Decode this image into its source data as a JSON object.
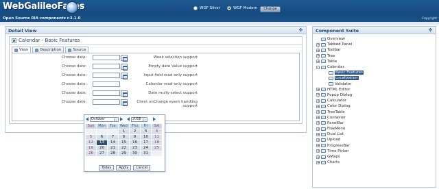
{
  "app": {
    "logo_text": "WebGalileoFaces",
    "subtitle": "Open Source RIA components r.3.1.0",
    "copyright": "Copyright",
    "themes": [
      {
        "label": "WGF Silver",
        "selected": false
      },
      {
        "label": "WGF Modern",
        "selected": true
      }
    ],
    "change_label": "Change"
  },
  "detail": {
    "panel_title": "Detail View",
    "section_title": "Calendar - Basic Features",
    "tabs": [
      {
        "label": "View",
        "active": true
      },
      {
        "label": "Description",
        "active": false
      },
      {
        "label": "Source",
        "active": false
      }
    ],
    "rows": [
      {
        "label": "Choose date:",
        "value": "",
        "description": "Week selection support",
        "has_button": true
      },
      {
        "label": "Choose date:",
        "value": "",
        "description": "Empty date Value support",
        "has_button": true
      },
      {
        "label": "Choose date:",
        "value": "",
        "description": "Input field read-only support",
        "has_button": true
      },
      {
        "label": "Choose date:",
        "value": "",
        "description": "Calendar read-only support",
        "has_button": false
      },
      {
        "label": "Choose date:",
        "value": "",
        "description": "Date multy-select support",
        "has_button": true
      },
      {
        "label": "Choose date:",
        "value": "",
        "description": "Client onChange event handling support",
        "has_button": true
      }
    ]
  },
  "calendar": {
    "month": "October",
    "year": "2008",
    "weekdays": [
      "Sun",
      "Mon",
      "Tue",
      "Wed",
      "Thu",
      "Fri",
      "Sat"
    ],
    "weeks": [
      [
        "",
        "",
        "",
        "1",
        "2",
        "3",
        "4"
      ],
      [
        "5",
        "6",
        "7",
        "8",
        "9",
        "10",
        "11"
      ],
      [
        "12",
        "13",
        "14",
        "15",
        "16",
        "17",
        "18"
      ],
      [
        "19",
        "20",
        "21",
        "22",
        "23",
        "24",
        "25"
      ],
      [
        "26",
        "27",
        "28",
        "29",
        "30",
        "31",
        ""
      ]
    ],
    "highlighted_day": "13",
    "buttons": {
      "today": "Today",
      "apply": "Apply",
      "cancel": "Cancel"
    }
  },
  "suite": {
    "panel_title": "Component Suite",
    "tree": [
      {
        "label": "Overview",
        "level": 1,
        "expander": ""
      },
      {
        "label": "Tabbed Panel",
        "level": 1,
        "expander": "+"
      },
      {
        "label": "Toolbar",
        "level": 1,
        "expander": "+"
      },
      {
        "label": "Tree",
        "level": 1,
        "expander": "+"
      },
      {
        "label": "Table",
        "level": 1,
        "expander": "+"
      },
      {
        "label": "Calendar",
        "level": 1,
        "expander": "-"
      },
      {
        "label": "Basic Features",
        "level": 2,
        "expander": "",
        "selected": true
      },
      {
        "label": "Localization",
        "level": 2,
        "expander": "",
        "selected": true
      },
      {
        "label": "Validator",
        "level": 2,
        "expander": ""
      },
      {
        "label": "HTML Editor",
        "level": 1,
        "expander": "+"
      },
      {
        "label": "Popup Dialog",
        "level": 1,
        "expander": "+"
      },
      {
        "label": "Calculator",
        "level": 1,
        "expander": "+"
      },
      {
        "label": "Color Dialog",
        "level": 1,
        "expander": "+"
      },
      {
        "label": "TreeTable",
        "level": 1,
        "expander": "+"
      },
      {
        "label": "Container",
        "level": 1,
        "expander": "+"
      },
      {
        "label": "PanelBar",
        "level": 1,
        "expander": "+"
      },
      {
        "label": "FlexMenu",
        "level": 1,
        "expander": "+"
      },
      {
        "label": "Dual List",
        "level": 1,
        "expander": "+"
      },
      {
        "label": "Upload",
        "level": 1,
        "expander": "+"
      },
      {
        "label": "ProgressBar",
        "level": 1,
        "expander": "+"
      },
      {
        "label": "Time Picker",
        "level": 1,
        "expander": "+"
      },
      {
        "label": "GMaps",
        "level": 1,
        "expander": "+"
      },
      {
        "label": "Charts",
        "level": 1,
        "expander": "+"
      }
    ]
  },
  "colors": {
    "header_blue": "#1a5287",
    "selection_blue": "#28538a",
    "panel_border": "#b7c7d9"
  }
}
